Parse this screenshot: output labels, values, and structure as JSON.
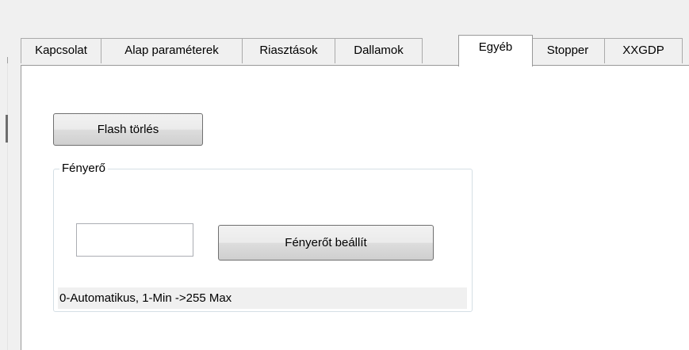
{
  "tabs": [
    {
      "label": "Kapcsolat",
      "active": false
    },
    {
      "label": "Alap paraméterek",
      "active": false
    },
    {
      "label": "Riasztások",
      "active": false
    },
    {
      "label": "Dallamok",
      "active": false
    },
    {
      "label": "Egyéb",
      "active": true
    },
    {
      "label": "Stopper",
      "active": false
    },
    {
      "label": "XXGDP",
      "active": false
    }
  ],
  "flash_clear_button": "Flash törlés",
  "brightness_group": {
    "legend": "Fényerő",
    "input_value": "",
    "set_button": "Fényerőt beállít",
    "hint": "0-Automatikus, 1-Min ->255 Max"
  }
}
